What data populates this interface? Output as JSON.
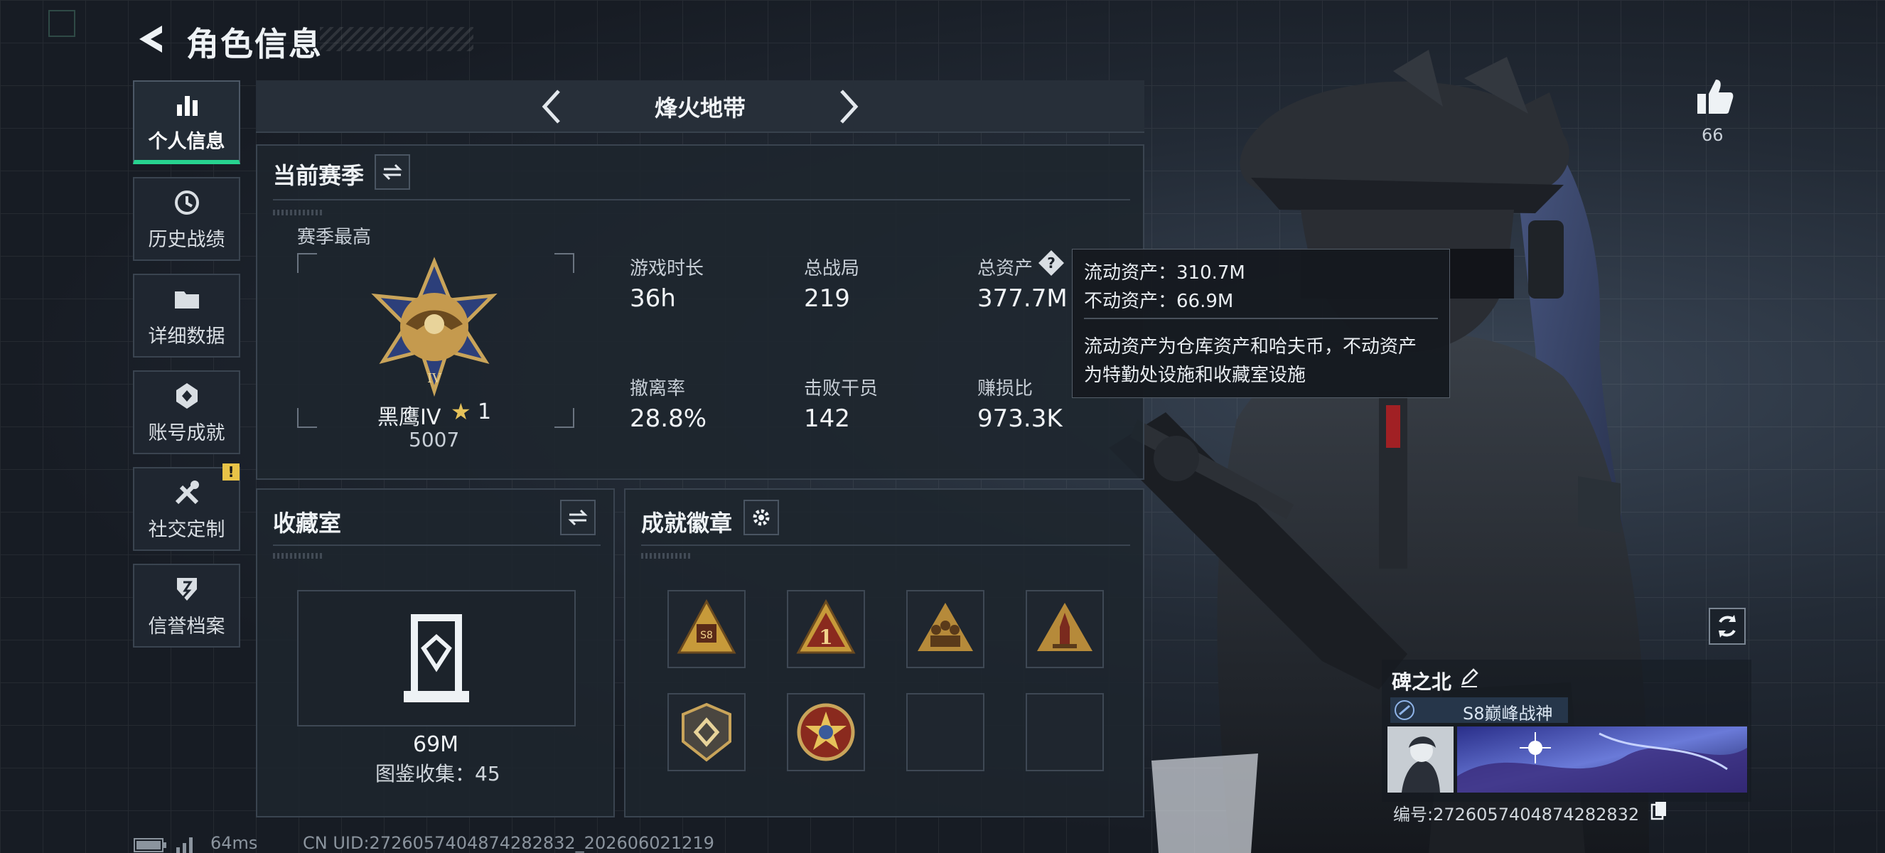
{
  "header": {
    "title": "角色信息"
  },
  "nav": [
    {
      "label": "个人信息",
      "icon": "bar-chart-icon",
      "active": true
    },
    {
      "label": "历史战绩",
      "icon": "history-clock-icon"
    },
    {
      "label": "详细数据",
      "icon": "folder-icon"
    },
    {
      "label": "账号成就",
      "icon": "achievement-medal-icon"
    },
    {
      "label": "社交定制",
      "icon": "tools-icon",
      "alert": "!"
    },
    {
      "label": "信誉档案",
      "icon": "credit-shield-icon"
    }
  ],
  "mode": {
    "title": "烽火地带"
  },
  "season": {
    "title": "当前赛季",
    "peak_label": "赛季最高",
    "rank_name": "黑鹰IV",
    "rank_stars": "1",
    "rank_score": "5007",
    "stats": [
      {
        "label": "游戏时长",
        "value": "36h"
      },
      {
        "label": "总战局",
        "value": "219"
      },
      {
        "label": "总资产",
        "value": "377.7M"
      },
      {
        "label": "撤离率",
        "value": "28.8%"
      },
      {
        "label": "击败干员",
        "value": "142"
      },
      {
        "label": "赚损比",
        "value": "973.3K"
      }
    ]
  },
  "tooltip": {
    "liquid": "流动资产：310.7M",
    "fixed": "不动资产：66.9M",
    "desc_line1": "流动资产为仓库资产和哈夫币，不动资产",
    "desc_line2": "为特勤处设施和收藏室设施"
  },
  "collection": {
    "title": "收藏室",
    "value": "69M",
    "catalog": "图鉴收集：45"
  },
  "badges": {
    "title": "成就徽章",
    "items": [
      "s8-rank-badge",
      "first-place-badge",
      "squad-badge",
      "rocket-badge",
      "shield-emblem-badge",
      "star-emblem-badge",
      "empty",
      "empty"
    ]
  },
  "profile": {
    "likes": "66",
    "player_name": "碑之北",
    "title_tag": "S8巅峰战神",
    "player_id": "编号:2726057404874282832"
  },
  "footer": {
    "ping": "64ms",
    "uid": "CN UID:2726057404874282832_202606021219"
  },
  "colors": {
    "accent": "#27d28f",
    "alert": "#e8c347",
    "panel_border": "#3a4450"
  }
}
